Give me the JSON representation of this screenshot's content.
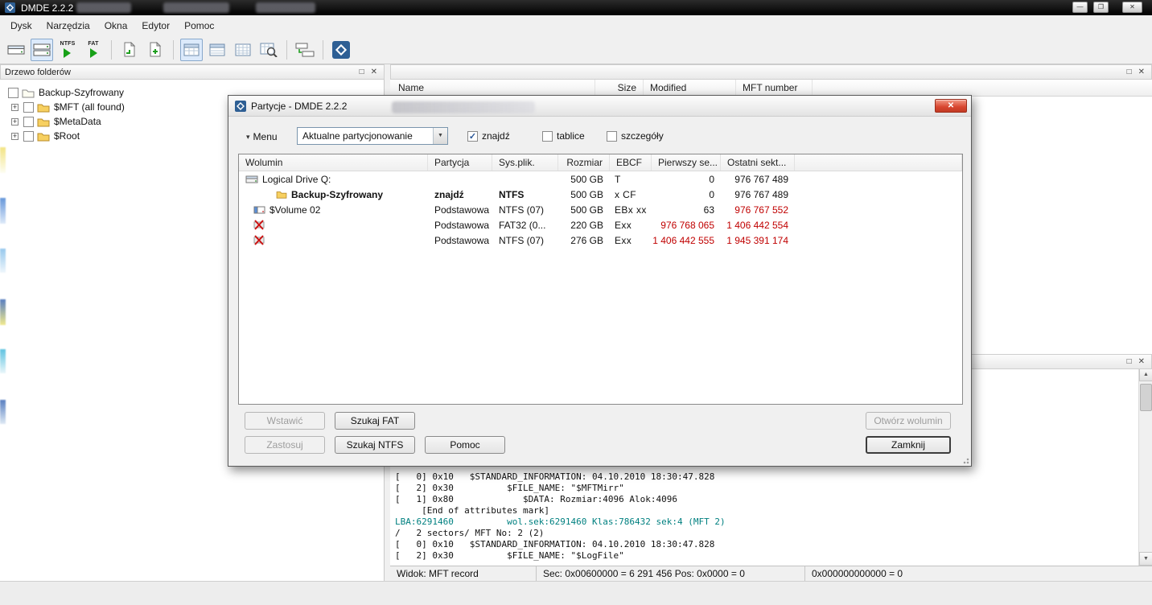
{
  "colors": {
    "danger": "#c00000",
    "teal": "#008080",
    "logo": "#2e5f94",
    "selection": "#dceafb"
  },
  "icons": {
    "minimize": "—",
    "restore": "❐",
    "close": "✕",
    "panel_restore": "□",
    "panel_close": "✕",
    "menu_arrow": "▾",
    "dropdown_arrow": "▼",
    "check": "✓",
    "scroll_up": "▲",
    "scroll_down": "▼",
    "tree_expand": "+"
  },
  "window": {
    "title": "DMDE 2.2.2"
  },
  "menubar": {
    "items": [
      "Dysk",
      "Narzędzia",
      "Okna",
      "Edytor",
      "Pomoc"
    ]
  },
  "toolbar": {
    "ntfs_label": "NTFS",
    "fat_label": "FAT"
  },
  "tree_panel": {
    "title": "Drzewo folderów",
    "items": [
      {
        "label": "Backup-Szyfrowany"
      },
      {
        "label": "$MFT (all found)"
      },
      {
        "label": "$MetaData"
      },
      {
        "label": "$Root"
      }
    ]
  },
  "file_panel": {
    "columns": {
      "name": "Name",
      "size": "Size",
      "modified": "Modified",
      "mft": "MFT number"
    }
  },
  "dialog": {
    "title": "Partycje - DMDE 2.2.2",
    "menu_label": "Menu",
    "mode_value": "Aktualne partycjonowanie",
    "check_znajdz": "znajdź",
    "check_tablice": "tablice",
    "check_szczegoly": "szczegóły",
    "table": {
      "columns": [
        "Wolumin",
        "Partycja",
        "Sys.plik.",
        "Rozmiar",
        "EBCF",
        "Pierwszy se...",
        "Ostatni sekt..."
      ],
      "rows": [
        {
          "icon": "drive",
          "name": "Logical Drive Q:",
          "partition": "",
          "fs": "",
          "size": "500 GB",
          "flags": "T",
          "first": "0",
          "last": "976 767 489"
        },
        {
          "icon": "folder",
          "name": "Backup-Szyfrowany",
          "partition": "znajdź",
          "fs": "NTFS",
          "size": "500 GB",
          "flags": "x CF",
          "first": "0",
          "last": "976 767 489"
        },
        {
          "icon": "volume",
          "name": "$Volume 02",
          "partition": "Podstawowa",
          "fs": "NTFS (07)",
          "size": "500 GB",
          "flags": "EBx xx",
          "first": "63",
          "last": "976 767 552"
        },
        {
          "icon": "deleted",
          "name": "",
          "partition": "Podstawowa (A)",
          "fs": "FAT32 (0...",
          "size": "220 GB",
          "flags": "Exx",
          "first": "976 768 065",
          "last": "1 406 442 554"
        },
        {
          "icon": "deleted",
          "name": "",
          "partition": "Podstawowa",
          "fs": "NTFS (07)",
          "size": "276 GB",
          "flags": "Exx",
          "first": "1 406 442 555",
          "last": "1 945 391 174"
        }
      ]
    },
    "buttons": {
      "wstawic": "Wstawić",
      "szukaj_fat": "Szukaj FAT",
      "zastosuj": "Zastosuj",
      "szukaj_ntfs": "Szukaj NTFS",
      "pomoc": "Pomoc",
      "otworz": "Otwórz wolumin",
      "zamknij": "Zamknij"
    }
  },
  "log_panel": {
    "lines": [
      {
        "text": "[   0] 0x10   $STANDARD_INFORMATION: 04.10.2010 18:30:47.828"
      },
      {
        "text": "[   2] 0x30          $FILE_NAME: \"$MFTMirr\""
      },
      {
        "text": "[   1] 0x80             $DATA: Rozmiar:4096 Alok:4096"
      },
      {
        "text": "     [End of attributes mark]"
      },
      {
        "text": "LBA:6291460          wol.sek:6291460 Klas:786432 sek:4 (MFT 2)"
      },
      {
        "text": "/   2 sectors/ MFT No: 2 (2)"
      },
      {
        "text": "[   0] 0x10   $STANDARD_INFORMATION: 04.10.2010 18:30:47.828"
      },
      {
        "text": "[   2] 0x30          $FILE_NAME: \"$LogFile\""
      }
    ]
  },
  "status_bar": {
    "view": "Widok: MFT record",
    "sector": "Sec: 0x00600000 = 6 291 456  Pos: 0x0000 = 0",
    "offset": "0x000000000000 = 0"
  }
}
